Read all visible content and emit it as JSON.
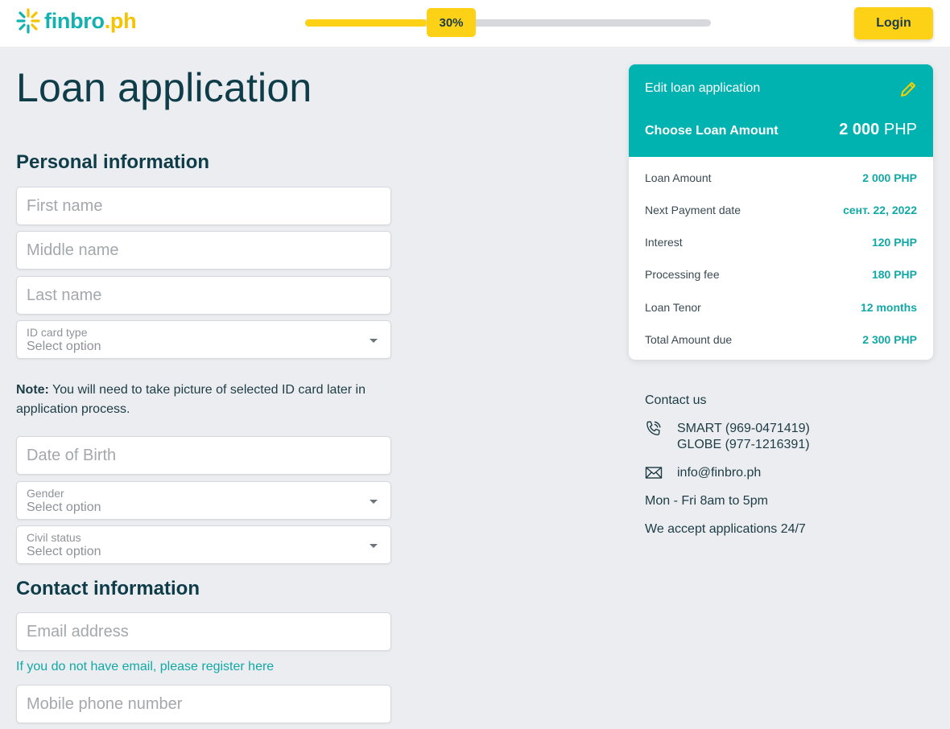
{
  "header": {
    "logo_text": "finbro",
    "logo_suffix": ".ph",
    "progress_percent": 30,
    "progress_label": "30%",
    "login_label": "Login"
  },
  "page": {
    "title": "Loan application"
  },
  "personal": {
    "title": "Personal information",
    "first_name_placeholder": "First name",
    "middle_name_placeholder": "Middle name",
    "last_name_placeholder": "Last name",
    "id_card_label": "ID card type",
    "id_card_value": "Select option",
    "note_bold": "Note:",
    "note_text": " You will need to take picture of selected ID card later in application process.",
    "dob_placeholder": "Date of Birth",
    "gender_label": "Gender",
    "gender_value": "Select option",
    "civil_label": "Civil status",
    "civil_value": "Select option"
  },
  "contact_info": {
    "title": "Contact information",
    "email_placeholder": "Email address",
    "register_link": "If you do not have email, please register here",
    "phone_placeholder": "Mobile phone number"
  },
  "summary": {
    "edit_label": "Edit loan application",
    "choose_label": "Choose Loan Amount",
    "amount_number": "2 000",
    "amount_currency": " PHP",
    "rows": [
      {
        "label": "Loan Amount",
        "value": "2 000 PHP"
      },
      {
        "label": "Next Payment date",
        "value": "сент. 22, 2022"
      },
      {
        "label": "Interest",
        "value": "120 PHP"
      },
      {
        "label": "Processing fee",
        "value": "180 PHP"
      },
      {
        "label": "Loan Tenor",
        "value": "12 months"
      },
      {
        "label": "Total Amount due",
        "value": "2 300 PHP"
      }
    ]
  },
  "contact_us": {
    "title": "Contact us",
    "phone_smart": "SMART (969-0471419)",
    "phone_globe": "GLOBE (977-1216391)",
    "email": "info@finbro.ph",
    "hours": "Mon - Fri 8am to 5pm",
    "applications": "We accept applications 24/7"
  },
  "colors": {
    "brand_teal": "#00b2b0",
    "brand_yellow": "#fcd116",
    "text_dark": "#0e3c48"
  }
}
